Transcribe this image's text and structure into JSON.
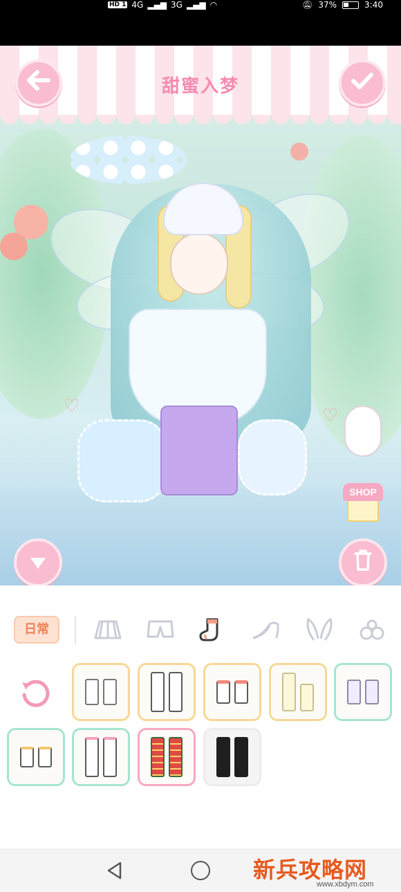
{
  "status_bar": {
    "left_text": "HD 1",
    "signal_a": "4G",
    "signal_b": "3G",
    "battery_percent": "37%",
    "time": "3:40"
  },
  "header": {
    "title": "甜蜜入梦",
    "back_icon": "arrow-left-icon",
    "confirm_icon": "check-icon"
  },
  "scene": {
    "shop_label": "SHOP",
    "collapse_icon": "triangle-down-icon",
    "delete_icon": "trash-icon"
  },
  "panel": {
    "category_tab_label": "日常",
    "category_icons": [
      "skirt-icon",
      "shorts-icon",
      "sock-icon",
      "heel-icon",
      "bunny-ears-icon",
      "flower-accessory-icon"
    ],
    "active_category": "sock-icon",
    "items": [
      {
        "name": "ruffle-ankle-socks",
        "style": "gold",
        "selected": false
      },
      {
        "name": "knee-high-white-socks",
        "style": "gold",
        "selected": false
      },
      {
        "name": "cherry-ankle-socks",
        "style": "gold",
        "selected": false
      },
      {
        "name": "cream-long-socks",
        "style": "gold",
        "selected": false
      },
      {
        "name": "lace-ankle-socks",
        "style": "teal",
        "selected": false
      },
      {
        "name": "short-frill-socks",
        "style": "teal",
        "selected": false
      },
      {
        "name": "ribbon-knee-socks",
        "style": "teal",
        "selected": false
      },
      {
        "name": "red-zigzag-socks",
        "style": "pink",
        "selected": true
      },
      {
        "name": "black-knee-socks",
        "style": "plain",
        "selected": false
      }
    ]
  },
  "nav": {
    "back_icon": "nav-back-icon",
    "home_icon": "nav-home-icon"
  },
  "watermark": {
    "title": "新兵攻略网",
    "url": "www.xbdym.com"
  }
}
